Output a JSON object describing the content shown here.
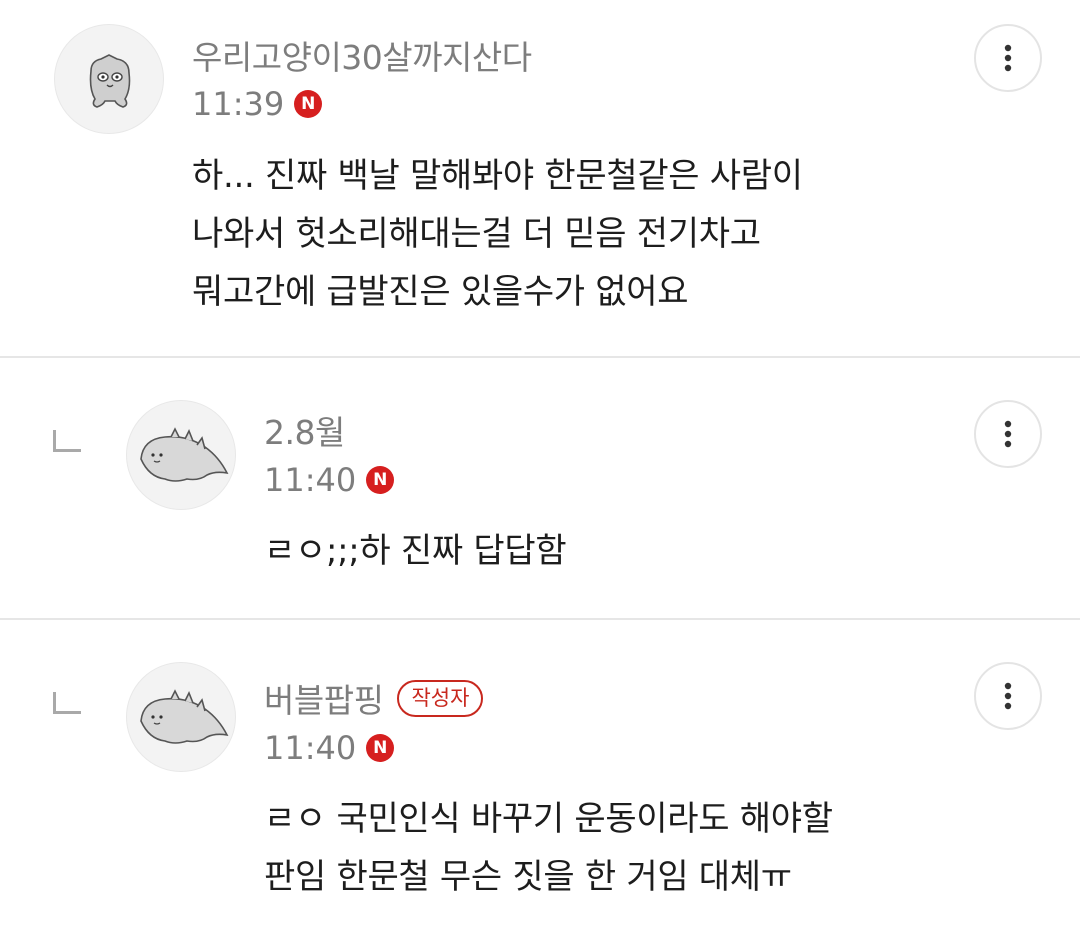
{
  "comments": [
    {
      "author": "우리고양이30살까지산다",
      "time": "11:39",
      "new_badge": "N",
      "text": "하... 진짜 백날 말해봐야 한문철같은 사람이\n나와서 헛소리해대는걸 더 믿음 전기차고\n뭐고간에 급발진은 있을수가 없어요",
      "avatar_icon": "cat-face-avatar-icon",
      "more_icon": "more-vertical-icon"
    },
    {
      "author": "2.8월",
      "time": "11:40",
      "new_badge": "N",
      "text": "ㄹㅇ;;;하 진짜 답답함",
      "avatar_icon": "dinosaur-avatar-icon",
      "reply_icon": "reply-arrow-icon",
      "more_icon": "more-vertical-icon"
    },
    {
      "author": "버블팝핑",
      "author_badge": "작성자",
      "time": "11:40",
      "new_badge": "N",
      "text": "ㄹㅇ 국민인식 바꾸기 운동이라도 해야할\n판임 한문철 무슨 짓을 한 거임 대체ㅠ",
      "avatar_icon": "dinosaur-avatar-icon",
      "reply_icon": "reply-arrow-icon",
      "more_icon": "more-vertical-icon"
    }
  ],
  "colors": {
    "meta_text": "#7d7d7d",
    "body_text": "#1d1d1d",
    "new_badge_bg": "#d61f1f",
    "author_badge": "#c8281e",
    "divider": "#e6e6e6"
  }
}
